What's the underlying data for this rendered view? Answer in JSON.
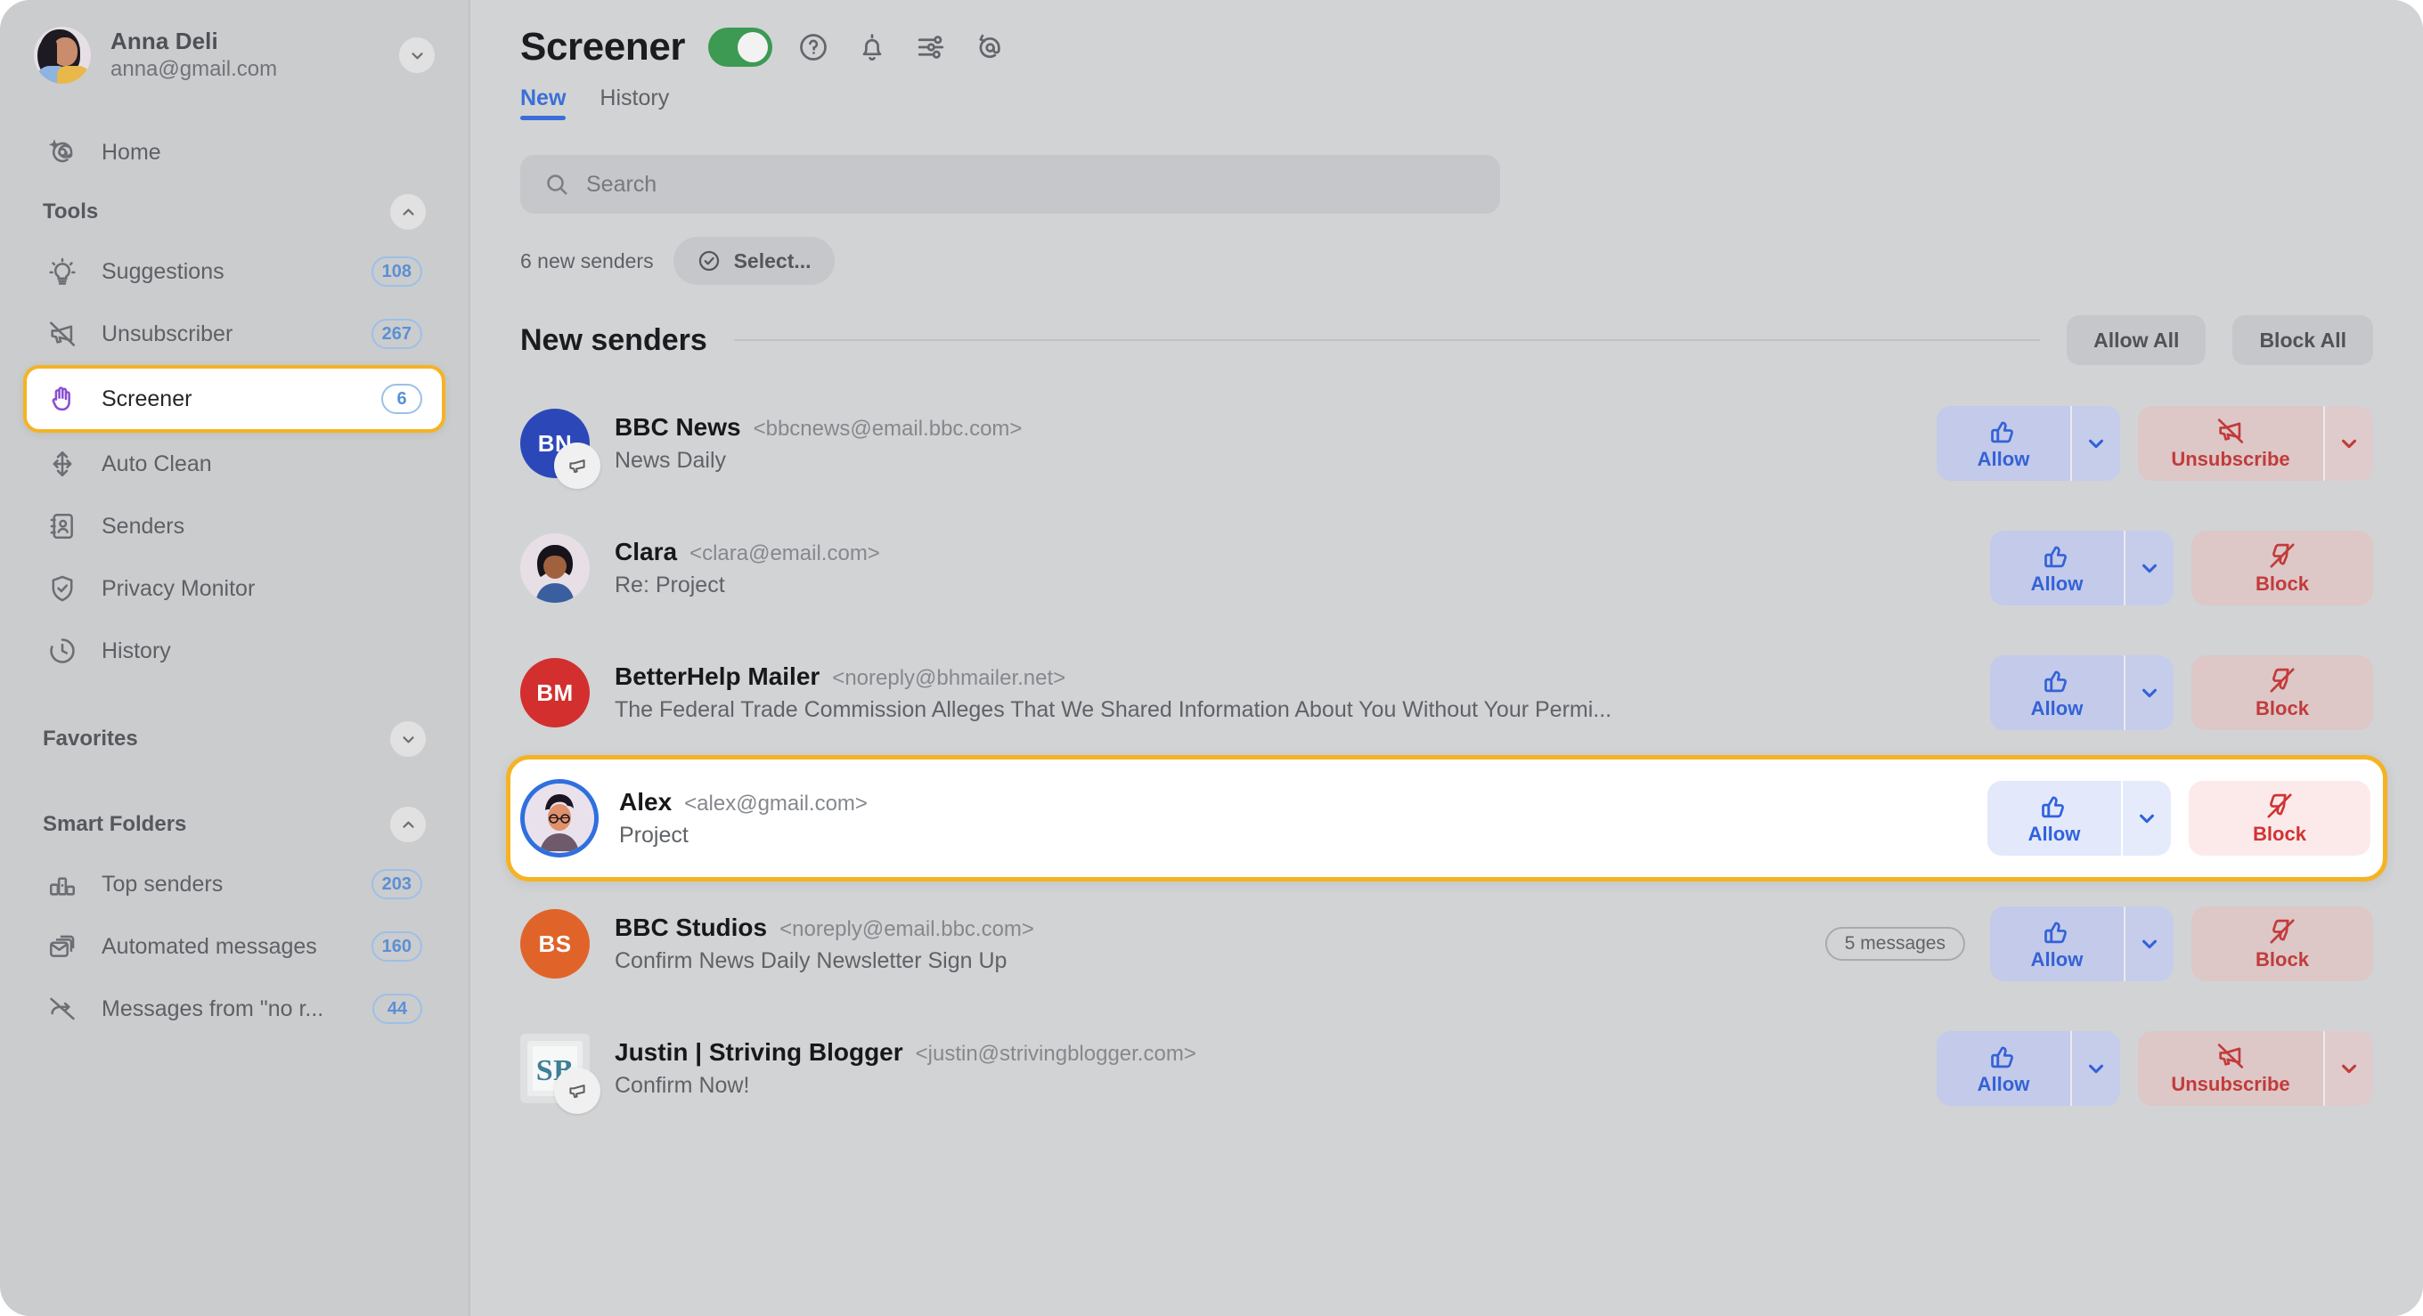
{
  "account": {
    "name": "Anna Deli",
    "email": "anna@gmail.com",
    "chevron_icon": "chevron-down-icon"
  },
  "sidebar": {
    "home": {
      "label": "Home",
      "icon": "at-sparkle-icon"
    },
    "tools_section": {
      "label": "Tools",
      "state": "expanded"
    },
    "tools": [
      {
        "label": "Suggestions",
        "badge": "108",
        "icon": "lightbulb-icon"
      },
      {
        "label": "Unsubscriber",
        "badge": "267",
        "icon": "megaphone-muted-icon"
      },
      {
        "label": "Screener",
        "badge": "6",
        "icon": "hand-raised-icon",
        "active": true
      },
      {
        "label": "Auto Clean",
        "badge": "",
        "icon": "auto-clean-icon"
      },
      {
        "label": "Senders",
        "badge": "",
        "icon": "contact-book-icon"
      },
      {
        "label": "Privacy Monitor",
        "badge": "",
        "icon": "shield-check-icon"
      },
      {
        "label": "History",
        "badge": "",
        "icon": "clock-icon"
      }
    ],
    "favorites_section": {
      "label": "Favorites",
      "state": "collapsed"
    },
    "smart_folders_section": {
      "label": "Smart Folders",
      "state": "expanded"
    },
    "smart_folders": [
      {
        "label": "Top senders",
        "badge": "203",
        "icon": "bar-chart-icon"
      },
      {
        "label": "Automated messages",
        "badge": "160",
        "icon": "stacked-mail-icon"
      },
      {
        "label": "Messages from \"no r...",
        "badge": "44",
        "icon": "no-reply-icon"
      }
    ]
  },
  "header": {
    "title": "Screener",
    "toggle_on": true,
    "icons": [
      "help-circle-icon",
      "bell-icon",
      "sliders-icon",
      "at-refresh-icon"
    ]
  },
  "tabs": [
    {
      "label": "New",
      "selected": true
    },
    {
      "label": "History",
      "selected": false
    }
  ],
  "search": {
    "placeholder": "Search",
    "value": "",
    "icon": "search-icon"
  },
  "toolbar": {
    "count_label": "6 new senders",
    "select_label": "Select...",
    "select_icon": "check-circle-icon"
  },
  "list": {
    "title": "New senders",
    "allow_all_label": "Allow All",
    "block_all_label": "Block All"
  },
  "senders": [
    {
      "name": "BBC News",
      "email": "<bbcnews@email.bbc.com>",
      "subject": "News Daily",
      "avatar": {
        "type": "initials",
        "text": "BN",
        "color": "#2c48b8"
      },
      "avatar_badge": "megaphone-icon",
      "messages_badge": "",
      "allow_label": "Allow",
      "deny_label": "Unsubscribe",
      "deny_icon": "megaphone-muted-icon",
      "deny_has_caret": true,
      "highlighted": false
    },
    {
      "name": "Clara",
      "email": "<clara@email.com>",
      "subject": "Re: Project",
      "avatar": {
        "type": "photo-clara",
        "text": "",
        "color": "#e7dfe5"
      },
      "avatar_badge": "",
      "messages_badge": "",
      "allow_label": "Allow",
      "deny_label": "Block",
      "deny_icon": "thumbs-down-blocked-icon",
      "deny_has_caret": false,
      "highlighted": false
    },
    {
      "name": "BetterHelp Mailer",
      "email": "<noreply@bhmailer.net>",
      "subject": "The Federal Trade Commission Alleges That We Shared Information About You Without Your Permi...",
      "avatar": {
        "type": "initials",
        "text": "BM",
        "color": "#d32f2f"
      },
      "avatar_badge": "",
      "messages_badge": "",
      "allow_label": "Allow",
      "deny_label": "Block",
      "deny_icon": "thumbs-down-blocked-icon",
      "deny_has_caret": false,
      "highlighted": false
    },
    {
      "name": "Alex",
      "email": "<alex@gmail.com>",
      "subject": "Project",
      "avatar": {
        "type": "photo-alex",
        "text": "",
        "color": "#e9e2ec"
      },
      "avatar_badge": "",
      "messages_badge": "",
      "allow_label": "Allow",
      "deny_label": "Block",
      "deny_icon": "thumbs-down-blocked-icon",
      "deny_has_caret": false,
      "highlighted": true
    },
    {
      "name": "BBC Studios",
      "email": "<noreply@email.bbc.com>",
      "subject": "Confirm News Daily Newsletter Sign Up",
      "avatar": {
        "type": "initials",
        "text": "BS",
        "color": "#e0642a"
      },
      "avatar_badge": "",
      "messages_badge": "5 messages",
      "allow_label": "Allow",
      "deny_label": "Block",
      "deny_icon": "thumbs-down-blocked-icon",
      "deny_has_caret": false,
      "highlighted": false
    },
    {
      "name": "Justin | Striving Blogger",
      "email": "<justin@strivingblogger.com>",
      "subject": "Confirm Now!",
      "avatar": {
        "type": "logo-sb",
        "text": "SB",
        "color": "#e7e8ea"
      },
      "avatar_badge": "megaphone-icon",
      "messages_badge": "",
      "allow_label": "Allow",
      "deny_label": "Unsubscribe",
      "deny_icon": "megaphone-muted-icon",
      "deny_has_caret": true,
      "highlighted": false
    }
  ],
  "colors": {
    "accent_blue": "#3a6fd8",
    "highlight_yellow": "#f5b323",
    "toggle_green": "#3c9a52",
    "allow_blue": "#3462d6",
    "deny_red": "#c23b3b"
  }
}
